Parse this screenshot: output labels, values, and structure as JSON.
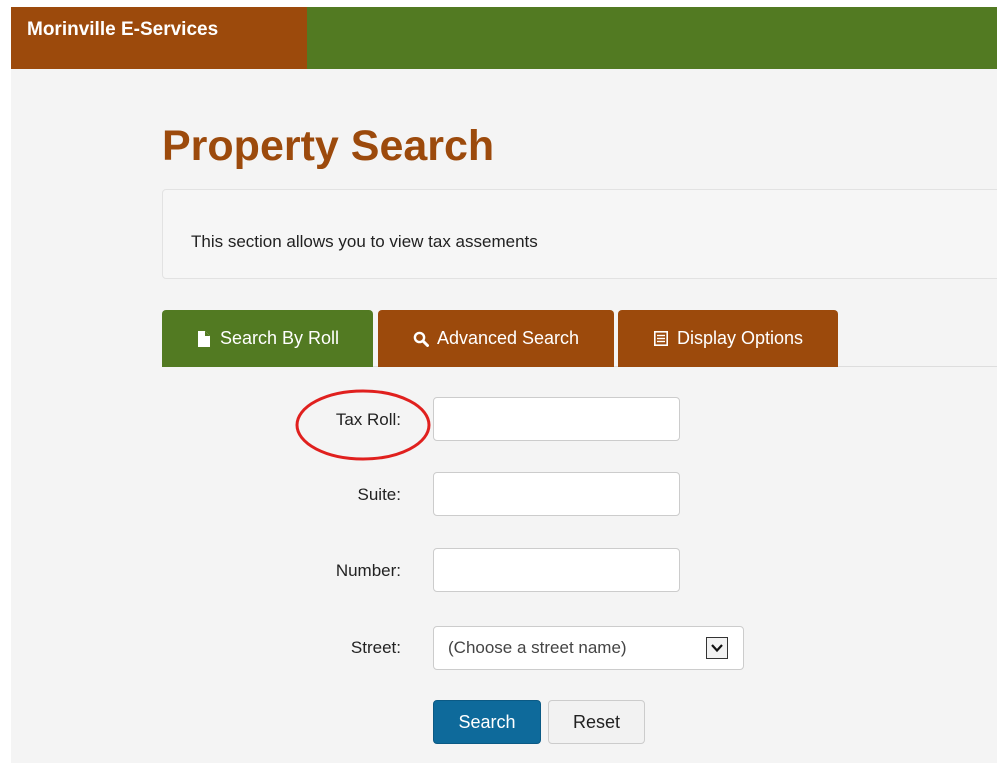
{
  "navbar": {
    "brand": "Morinville E-Services"
  },
  "page": {
    "title": "Property Search",
    "description": "This section allows you to view tax assements"
  },
  "tabs": [
    {
      "label": "Search By Roll",
      "icon": "file-icon",
      "active": true
    },
    {
      "label": "Advanced Search",
      "icon": "search-icon",
      "active": false
    },
    {
      "label": "Display Options",
      "icon": "list-icon",
      "active": false
    }
  ],
  "form": {
    "tax_roll_label": "Tax Roll:",
    "tax_roll_value": "",
    "suite_label": "Suite:",
    "suite_value": "",
    "number_label": "Number:",
    "number_value": "",
    "street_label": "Street:",
    "street_selected": "(Choose a street name)",
    "search_label": "Search",
    "reset_label": "Reset"
  },
  "colors": {
    "brand_brown": "#9c4a0c",
    "nav_green": "#527a22",
    "primary_button": "#0e6a9b",
    "annotation_red": "#e0201e"
  }
}
